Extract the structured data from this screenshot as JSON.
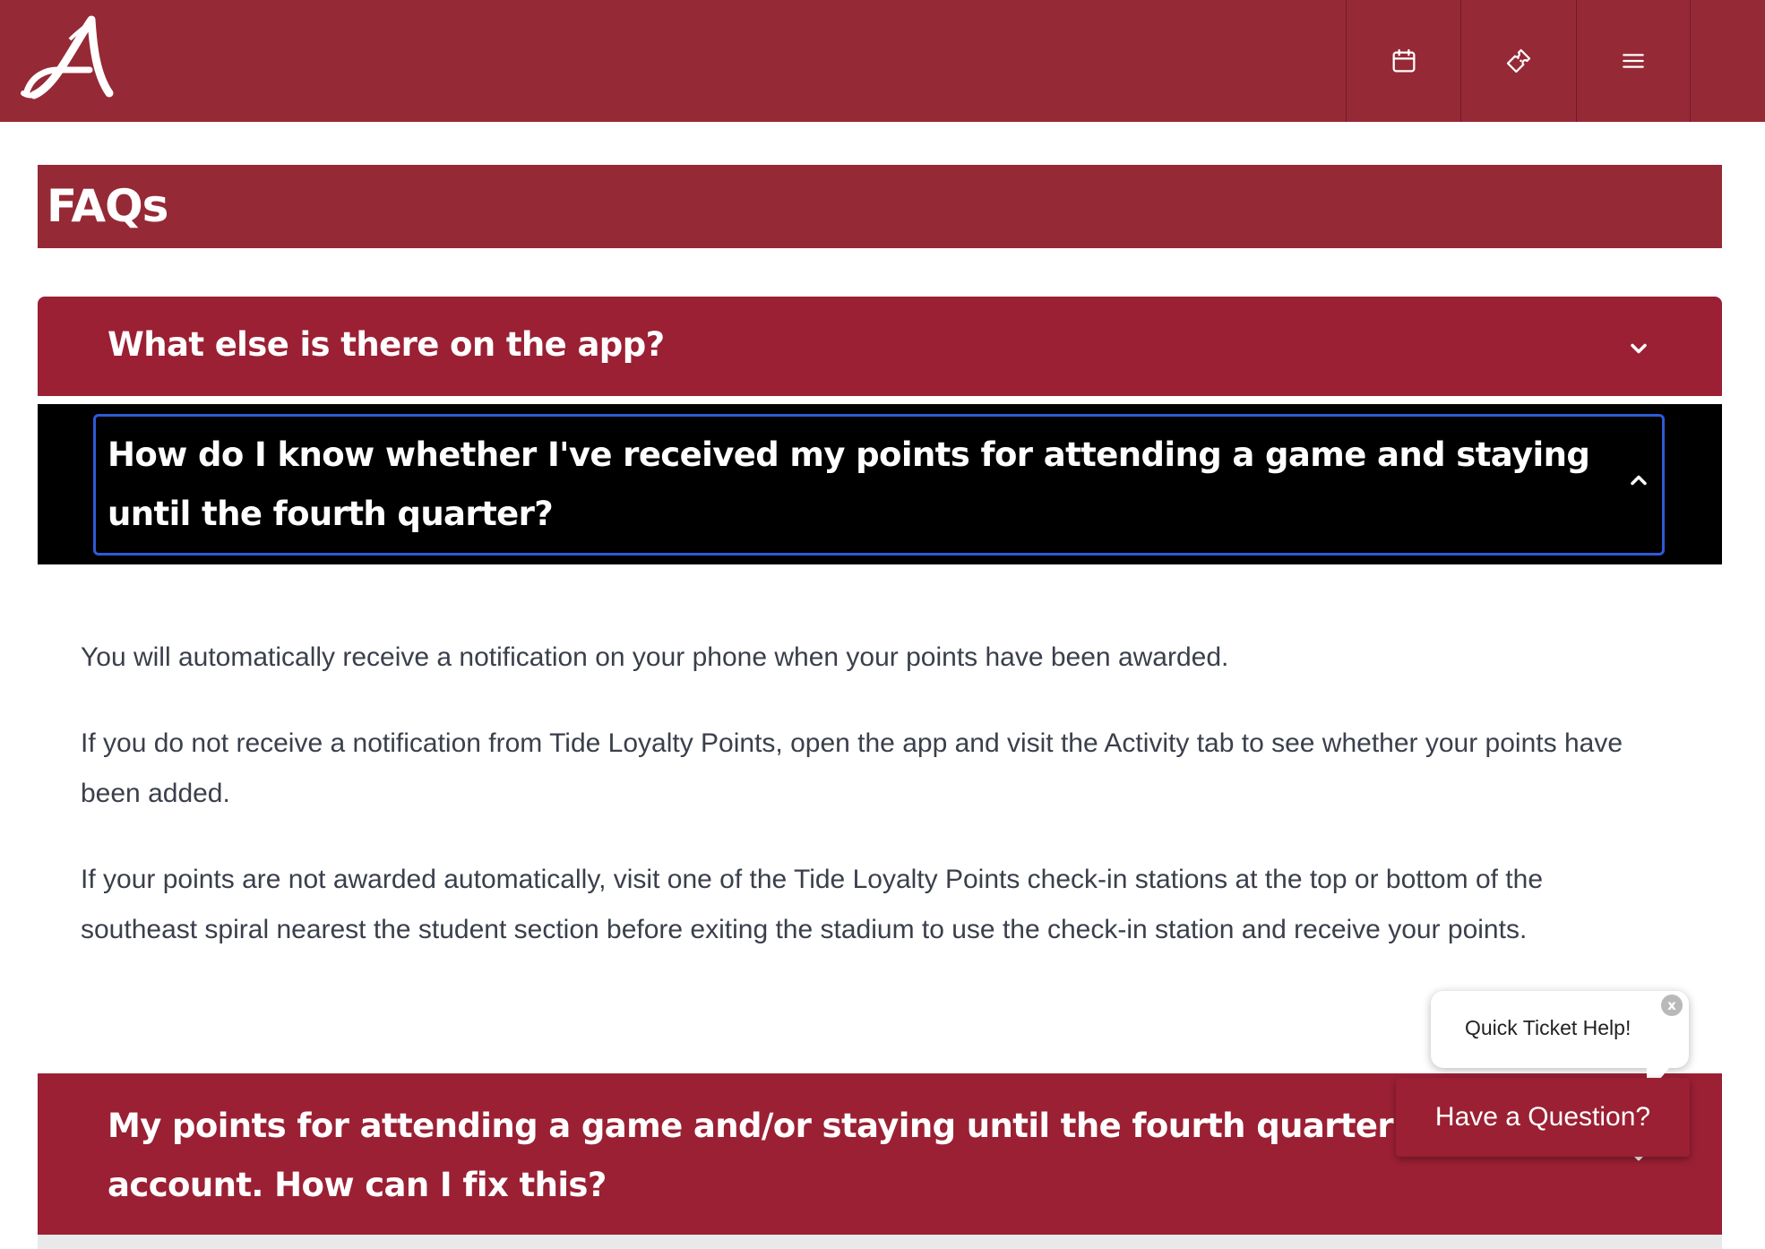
{
  "header": {
    "logo_icon": "script-a-logo",
    "nav": [
      {
        "icon": "calendar-icon"
      },
      {
        "icon": "ticket-icon"
      },
      {
        "icon": "menu-icon"
      }
    ],
    "background": "#962936"
  },
  "page": {
    "title": "FAQs"
  },
  "faq": {
    "items": [
      {
        "question": "What else is there on the app?",
        "state": "collapsed"
      },
      {
        "question": "How do I know whether I've received my points for attending a game and staying until the fourth quarter?",
        "state": "expanded"
      },
      {
        "question": "My points for attending a game and/or staying until the fourth quarter are not in my account. How can I fix this?",
        "state": "collapsed"
      }
    ],
    "answer": [
      "You will automatically receive a notification on your phone when your points have been awarded.",
      "If you do not receive a notification from Tide Loyalty Points, open the app and visit the Activity tab to see whether your points have been added.",
      "If your points are not awarded automatically, visit one of the Tide Loyalty Points check-in stations at the top or bottom of the southeast spiral nearest the student section before exiting the stadium to use the check-in station and receive your points."
    ]
  },
  "chat": {
    "bubble_text": "Quick Ticket Help!",
    "close_label": "x",
    "button_label": "Have a Question?"
  },
  "colors": {
    "crimson": "#9b2034",
    "header": "#962936",
    "focus": "#2f5ad6",
    "text": "#3a3f4b"
  }
}
